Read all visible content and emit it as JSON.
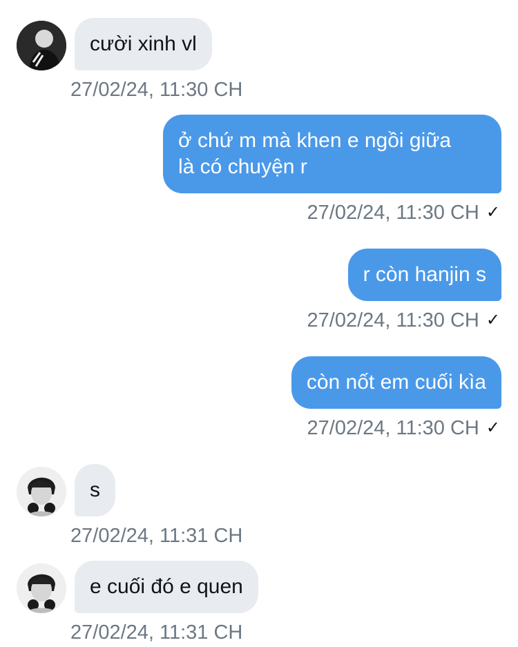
{
  "conversation": {
    "messages": [
      {
        "direction": "incoming",
        "text": "cười xinh vl",
        "time": "27/02/24, 11:30 CH",
        "avatar": "avatar-icon"
      },
      {
        "direction": "outgoing",
        "text": "ở chứ m mà khen e ngồi giữa\nlà có chuyện r",
        "time": "27/02/24, 11:30 CH",
        "status_icon": "checkmark-icon",
        "status_glyph": "✓"
      },
      {
        "direction": "outgoing",
        "text": "r còn hanjin s",
        "time": "27/02/24, 11:30 CH",
        "status_icon": "checkmark-icon",
        "status_glyph": "✓"
      },
      {
        "direction": "outgoing",
        "text": "còn nốt em cuối kìa",
        "time": "27/02/24, 11:30 CH",
        "status_icon": "checkmark-icon",
        "status_glyph": "✓"
      },
      {
        "direction": "incoming",
        "text": "s",
        "time": "27/02/24, 11:31 CH",
        "avatar": "avatar-icon"
      },
      {
        "direction": "incoming",
        "text": "e cuối đó e quen",
        "time": "27/02/24, 11:31 CH",
        "avatar": "avatar-icon"
      }
    ]
  },
  "colors": {
    "incoming_bubble": "#e8ebef",
    "outgoing_bubble": "#4a99e9",
    "timestamp": "#6b7783"
  }
}
